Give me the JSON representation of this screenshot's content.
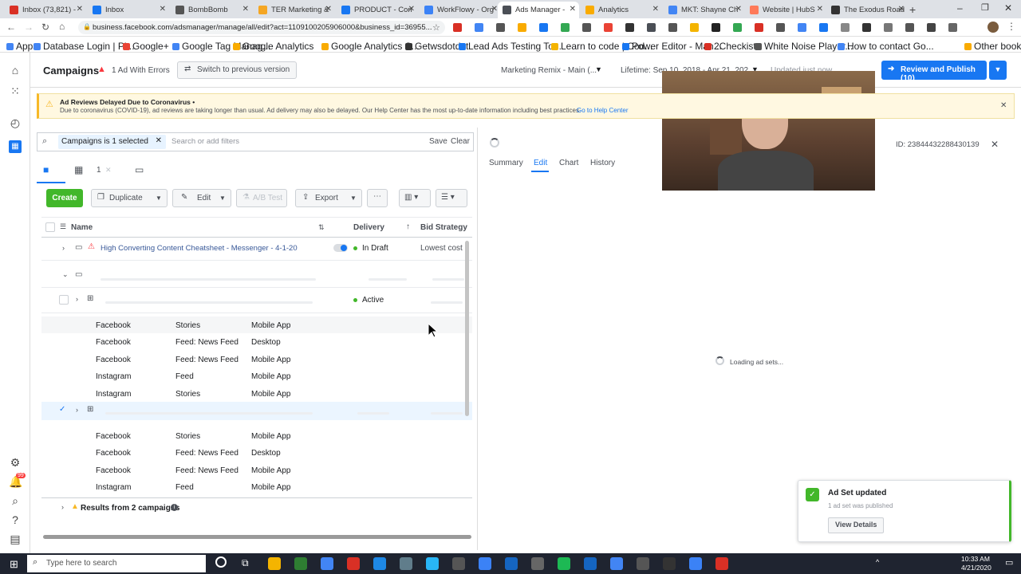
{
  "browser": {
    "tabs": [
      {
        "title": "Inbox (73,821) -",
        "color": "#d93025"
      },
      {
        "title": "Inbox",
        "color": "#1877f2"
      },
      {
        "title": "BombBomb",
        "color": "#555"
      },
      {
        "title": "TER Marketing &",
        "color": "#f5a623"
      },
      {
        "title": "PRODUCT - Con",
        "color": "#1877f2"
      },
      {
        "title": "WorkFlowy - Org",
        "color": "#3b82f6"
      },
      {
        "title": "Ads Manager -",
        "color": "#4b4f56"
      },
      {
        "title": "Analytics",
        "color": "#f9ab00"
      },
      {
        "title": "MKT: Shayne Ch",
        "color": "#4285f4"
      },
      {
        "title": "Website | HubS",
        "color": "#ff7a59"
      },
      {
        "title": "The Exodus Road",
        "color": "#333"
      }
    ],
    "url": "business.facebook.com/adsmanager/manage/all/edit?act=1109100205906000&business_id=36955...",
    "bookmarks": [
      "Apps",
      "Database Login | Pi...",
      "Google+",
      "Google Tag Manag...",
      "Google Analytics",
      "Google Analytics S...",
      "Getwsdotdot",
      "Lead Ads Testing To...",
      "Learn to code | Cod...",
      "Power Editor - Man...",
      "2Checkist",
      "White Noise Player...",
      "How to contact Go...",
      "Other bookmarks"
    ]
  },
  "header": {
    "title": "Campaigns",
    "errors": "1 Ad With Errors",
    "switch_version": "Switch to previous version",
    "account": "Marketing Remix - Main (...",
    "date_range": "Lifetime: Sep 10, 2018 - Apr 21, 2020",
    "updated": "Updated just now",
    "review_publish": "Review and Publish (10)"
  },
  "banner": {
    "title": "Ad Reviews Delayed Due to Coronavirus •",
    "body": "Due to coronavirus (COVID-19), ad reviews are taking longer than usual. Ad delivery may also be delayed. Our Help Center has the most up-to-date information including best practices.",
    "link": "Go to Help Center"
  },
  "filter": {
    "chip": "Campaigns is 1 selected",
    "placeholder": "Search or add filters",
    "save": "Save",
    "clear": "Clear"
  },
  "level_tabs": {
    "count": "1"
  },
  "toolbar": {
    "create": "Create",
    "duplicate": "Duplicate",
    "edit": "Edit",
    "ab_test": "A/B Test",
    "export": "Export"
  },
  "table": {
    "headers": {
      "name": "Name",
      "delivery": "Delivery",
      "bid": "Bid Strategy"
    },
    "campaign": {
      "name": "High Converting Content Cheatsheet - Messenger - 4-1-20",
      "delivery": "In Draft",
      "bid": "Lowest cost"
    },
    "adset_status": "Active",
    "placements_a": [
      {
        "platform": "Facebook",
        "position": "Stories",
        "device": "Mobile App"
      },
      {
        "platform": "Facebook",
        "position": "Feed: News Feed",
        "device": "Desktop"
      },
      {
        "platform": "Facebook",
        "position": "Feed: News Feed",
        "device": "Mobile App"
      },
      {
        "platform": "Instagram",
        "position": "Feed",
        "device": "Mobile App"
      },
      {
        "platform": "Instagram",
        "position": "Stories",
        "device": "Mobile App"
      }
    ],
    "placements_b": [
      {
        "platform": "Facebook",
        "position": "Stories",
        "device": "Mobile App"
      },
      {
        "platform": "Facebook",
        "position": "Feed: News Feed",
        "device": "Desktop"
      },
      {
        "platform": "Facebook",
        "position": "Feed: News Feed",
        "device": "Mobile App"
      },
      {
        "platform": "Instagram",
        "position": "Feed",
        "device": "Mobile App"
      }
    ],
    "results_footer": "Results from 2 campaigns"
  },
  "panel": {
    "tabs": {
      "summary": "Summary",
      "edit": "Edit",
      "chart": "Chart",
      "history": "History"
    },
    "id_label": "ID: 23844432288430139",
    "loading": "Loading ad sets..."
  },
  "toast": {
    "title": "Ad Set updated",
    "subtitle": "1 ad set was published",
    "button": "View Details"
  },
  "taskbar": {
    "search_placeholder": "Type here to search",
    "time": "10:33 AM",
    "date": "4/21/2020"
  }
}
